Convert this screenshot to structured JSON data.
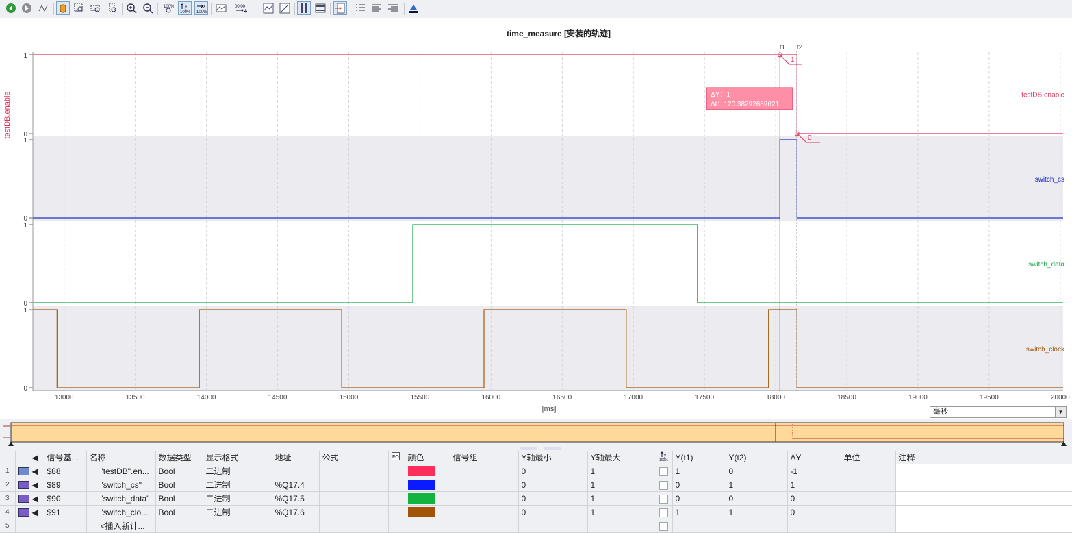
{
  "toolbar": {
    "buttons": [
      "back",
      "forward",
      "wave-tool",
      "hand-tool",
      "zoom-rect",
      "zoom-x",
      "zoom-y",
      "zoom-in",
      "zoom-out",
      "zoom-100",
      "y-100",
      "x-100",
      "signal-view",
      "time-set",
      "curve-1",
      "curve-2",
      "cursor-t",
      "cursor-y",
      "export",
      "list-1",
      "list-2",
      "list-3",
      "print"
    ]
  },
  "chart": {
    "title": "time_measure [安装的轨迹]",
    "ylabel": "testDB.enable",
    "xlabel": "[ms]",
    "cursor_t1_label": "t1",
    "cursor_t2_label": "t2",
    "tooltip_dy": "ΔY：1",
    "tooltip_dt": "Δt：120.38292689621",
    "marker_t1_value": "1",
    "marker_t2_value": "0",
    "unit_select": "毫秒"
  },
  "chart_data": {
    "type": "line",
    "x_range": [
      12780,
      20020
    ],
    "x_ticks": [
      13000,
      13500,
      14000,
      14500,
      15000,
      15500,
      16000,
      16500,
      17000,
      17500,
      18000,
      18500,
      19000,
      19500,
      20000
    ],
    "ylim": [
      0,
      1
    ],
    "cursors": {
      "t1": 18030,
      "t2": 18150
    },
    "series": [
      {
        "name": "testDB.enable",
        "color": "#e0345a",
        "points": [
          [
            12780,
            1
          ],
          [
            18150,
            1
          ],
          [
            18150,
            0
          ],
          [
            20020,
            0
          ]
        ]
      },
      {
        "name": "switch_cs",
        "color": "#2230c8",
        "points": [
          [
            12780,
            0
          ],
          [
            18030,
            0
          ],
          [
            18030,
            1
          ],
          [
            18150,
            1
          ],
          [
            18150,
            0
          ],
          [
            20020,
            0
          ]
        ]
      },
      {
        "name": "switch_data",
        "color": "#1aab4c",
        "points": [
          [
            12780,
            0
          ],
          [
            15450,
            0
          ],
          [
            15450,
            1
          ],
          [
            17450,
            1
          ],
          [
            17450,
            0
          ],
          [
            20020,
            0
          ]
        ]
      },
      {
        "name": "switch_clock",
        "color": "#a35a0a",
        "points": [
          [
            12780,
            1
          ],
          [
            12950,
            1
          ],
          [
            12950,
            0
          ],
          [
            13950,
            0
          ],
          [
            13950,
            1
          ],
          [
            14950,
            1
          ],
          [
            14950,
            0
          ],
          [
            15950,
            0
          ],
          [
            15950,
            1
          ],
          [
            16950,
            1
          ],
          [
            16950,
            0
          ],
          [
            17950,
            0
          ],
          [
            17950,
            1
          ],
          [
            18150,
            1
          ],
          [
            18150,
            0
          ],
          [
            20020,
            0
          ]
        ]
      }
    ]
  },
  "grid": {
    "headers": [
      "信号基...",
      "名称",
      "数据类型",
      "显示格式",
      "地址",
      "公式",
      "颜色",
      "信号组",
      "Y轴最小",
      "Y轴最大",
      "Y(t1)",
      "Y(t2)",
      "ΔY",
      "单位",
      "注释"
    ],
    "rows": [
      {
        "num": "1",
        "base": "$88",
        "name": "\"testDB\".en...",
        "type": "Bool",
        "format": "二进制",
        "addr": "",
        "color": "#ff2d5a",
        "ymin": "0",
        "ymax": "1",
        "yt1": "1",
        "yt2": "0",
        "dy": "-1"
      },
      {
        "num": "2",
        "base": "$89",
        "name": "\"switch_cs\"",
        "type": "Bool",
        "format": "二进制",
        "addr": "%Q17.4",
        "color": "#0a1cff",
        "ymin": "0",
        "ymax": "1",
        "yt1": "0",
        "yt2": "1",
        "dy": "1"
      },
      {
        "num": "3",
        "base": "$90",
        "name": "\"switch_data\"",
        "type": "Bool",
        "format": "二进制",
        "addr": "%Q17.5",
        "color": "#12b33f",
        "ymin": "0",
        "ymax": "1",
        "yt1": "0",
        "yt2": "0",
        "dy": "0"
      },
      {
        "num": "4",
        "base": "$91",
        "name": "\"switch_clo...",
        "type": "Bool",
        "format": "二进制",
        "addr": "%Q17.6",
        "color": "#a35307",
        "ymin": "0",
        "ymax": "1",
        "yt1": "1",
        "yt2": "1",
        "dy": "0"
      }
    ],
    "add_row": {
      "num": "5",
      "label": "<插入新计..."
    }
  }
}
